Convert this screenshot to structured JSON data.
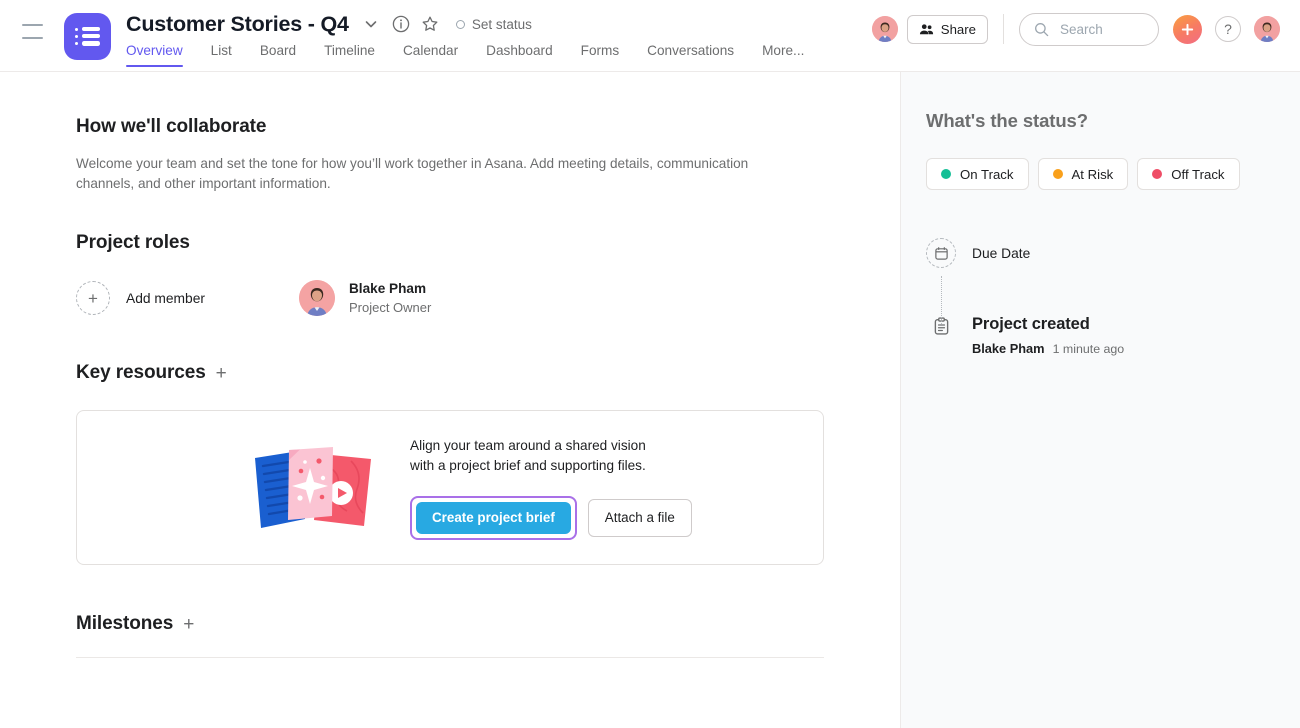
{
  "header": {
    "menu_icon": "hamburger-icon",
    "project_icon": "project-list-icon",
    "project_title": "Customer Stories - Q4",
    "chevron_icon": "chevron-down-icon",
    "info_icon": "info-circle-icon",
    "star_icon": "star-outline-icon",
    "set_status_label": "Set status",
    "tabs": [
      {
        "label": "Overview",
        "active": true
      },
      {
        "label": "List",
        "active": false
      },
      {
        "label": "Board",
        "active": false
      },
      {
        "label": "Timeline",
        "active": false
      },
      {
        "label": "Calendar",
        "active": false
      },
      {
        "label": "Dashboard",
        "active": false
      },
      {
        "label": "Forms",
        "active": false
      },
      {
        "label": "Conversations",
        "active": false
      },
      {
        "label": "More...",
        "active": false
      }
    ],
    "share_label": "Share",
    "share_icon": "people-icon",
    "search_placeholder": "Search",
    "search_value": "",
    "search_icon": "search-icon",
    "plus_label": "+",
    "help_label": "?",
    "avatar_name": "Blake Pham"
  },
  "main": {
    "collaborate": {
      "heading": "How we'll collaborate",
      "description": "Welcome your team and set the tone for how you’ll work together in Asana. Add meeting details, communication channels, and other important information."
    },
    "project_roles": {
      "heading": "Project roles",
      "add_member_label": "Add member",
      "add_member_icon": "plus-icon",
      "members": [
        {
          "name": "Blake Pham",
          "role": "Project Owner"
        }
      ]
    },
    "key_resources": {
      "heading": "Key resources",
      "add_icon": "plus-icon",
      "illustration": "documents-illustration",
      "promo_text_line1": "Align your team around a shared vision",
      "promo_text_line2": "with a project brief and supporting files.",
      "primary_button": "Create project brief",
      "secondary_button": "Attach a file"
    },
    "milestones": {
      "heading": "Milestones",
      "add_icon": "plus-icon"
    }
  },
  "right_panel": {
    "title": "What's the status?",
    "status_options": [
      {
        "label": "On Track",
        "color": "#14bf96"
      },
      {
        "label": "At Risk",
        "color": "#f9a01b"
      },
      {
        "label": "Off Track",
        "color": "#ef4d66"
      }
    ],
    "timeline": {
      "due_date_label": "Due Date",
      "due_date_icon": "calendar-icon",
      "created_label": "Project created",
      "created_icon": "clipboard-icon",
      "created_author": "Blake Pham",
      "created_time": "1 minute ago"
    }
  },
  "colors": {
    "brand_purple": "#6258ef",
    "primary_blue": "#28a9e2",
    "focus_ring": "#a970e8",
    "text_dark": "#1e1f21",
    "text_muted": "#6d6e6f"
  }
}
